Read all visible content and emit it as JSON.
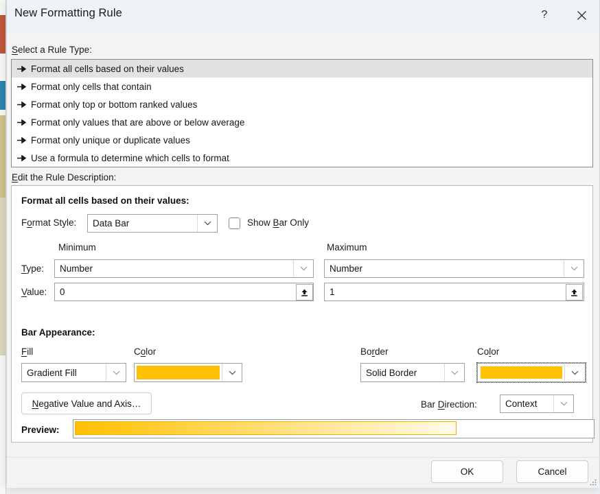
{
  "window": {
    "title": "New Formatting Rule",
    "help_icon": "?",
    "help_icon_name": "help-icon",
    "close_icon_name": "close-icon"
  },
  "rule_type": {
    "label": "Select a Rule Type:",
    "items": [
      {
        "label": "Format all cells based on their values",
        "selected": true
      },
      {
        "label": "Format only cells that contain",
        "selected": false
      },
      {
        "label": "Format only top or bottom ranked values",
        "selected": false
      },
      {
        "label": "Format only values that are above or below average",
        "selected": false
      },
      {
        "label": "Format only unique or duplicate values",
        "selected": false
      },
      {
        "label": "Use a formula to determine which cells to format",
        "selected": false
      }
    ]
  },
  "rule_description": {
    "label": "Edit the Rule Description:",
    "heading": "Format all cells based on their values:",
    "format_style": {
      "label": "Format Style:",
      "value": "Data Bar"
    },
    "show_bar_only": {
      "label": "Show Bar Only",
      "checked": false
    },
    "minimum": {
      "header": "Minimum",
      "type_label": "Type:",
      "type_value": "Number",
      "value_label": "Value:",
      "value": "0"
    },
    "maximum": {
      "header": "Maximum",
      "type_value": "Number",
      "value": "1"
    },
    "bar_appearance": {
      "heading": "Bar Appearance:",
      "fill_label": "Fill",
      "fill_value": "Gradient Fill",
      "fill_color_label": "Color",
      "fill_color": "#FFC000",
      "border_label": "Border",
      "border_value": "Solid Border",
      "border_color_label": "Color",
      "border_color": "#FFC000"
    },
    "negative_button": "Negative Value and Axis…",
    "bar_direction": {
      "label": "Bar Direction:",
      "value": "Context"
    },
    "preview": {
      "label": "Preview:",
      "gradient_start": "#FFC000",
      "gradient_end": "#FFFBEB",
      "border_color": "#F0B400"
    }
  },
  "footer": {
    "ok": "OK",
    "cancel": "Cancel"
  }
}
